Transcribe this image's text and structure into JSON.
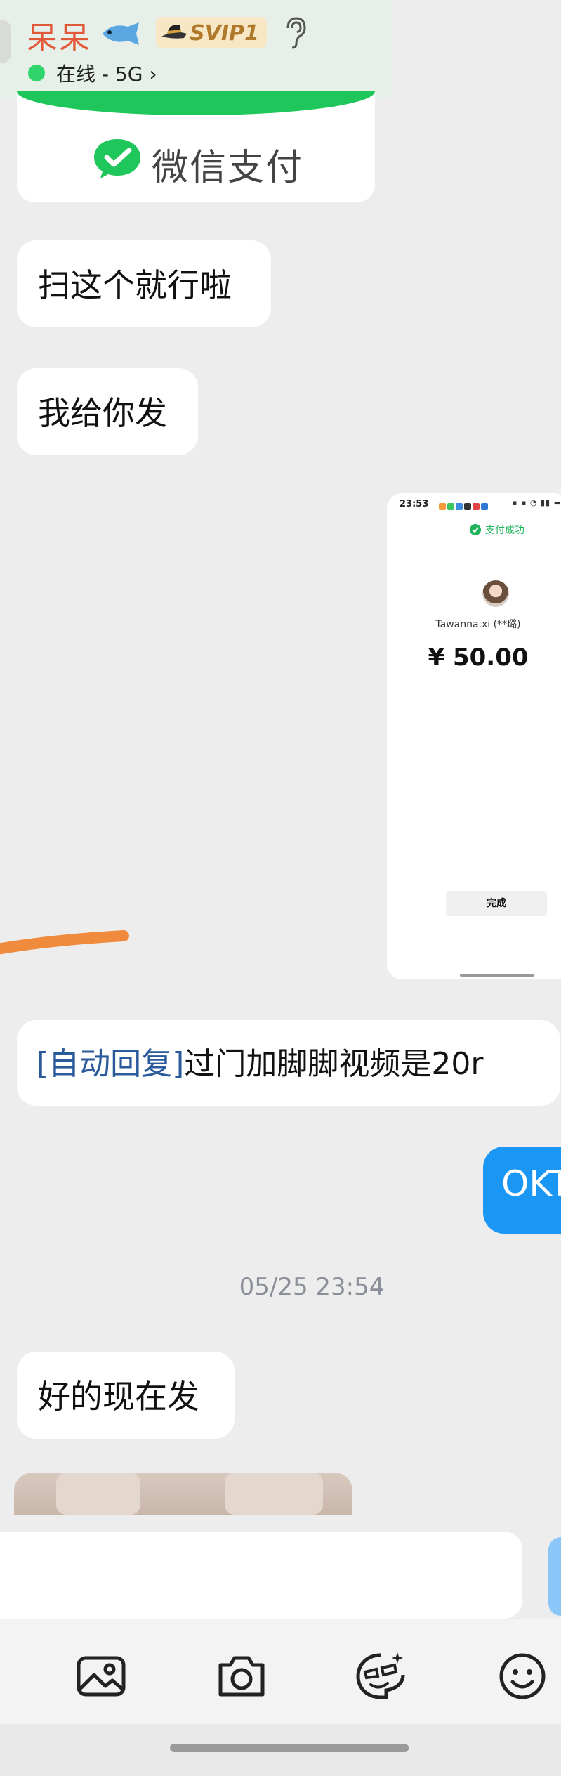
{
  "header": {
    "contact_name": "呆呆",
    "vip_label": "SVIP1",
    "status": "在线 - 5G",
    "status_chevron": "›",
    "icons": [
      "fish-emoji-icon",
      "hat-icon",
      "ear-icon",
      "status-dot-icon",
      "chevron-right-icon"
    ],
    "status_dot_color": "#2fd46a",
    "name_color": "#e2593a"
  },
  "messages": {
    "pay_card_label": "微信支付",
    "m1": "扫这个就行啦",
    "m2": "我给你发",
    "auto_reply_tag": "[自动回复]",
    "auto_reply_text": "过门加脚脚视频是20r",
    "my_reply": "OKT",
    "timestamp": "05/25 23:54",
    "m4": "好的现在发"
  },
  "payment_screenshot": {
    "time": "23:53",
    "status_title": "支付成功",
    "payee": "Tawanna.xi (**璐)",
    "amount": "¥ 50.00",
    "done_button": "完成",
    "brand_color": "#1fb35b"
  },
  "input": {
    "placeholder": ""
  },
  "toolbar": {
    "icons": [
      "image-icon",
      "camera-icon",
      "sticker-icon",
      "emoji-icon"
    ]
  },
  "colors": {
    "my_bubble": "#1a96f4",
    "wechat_green": "#1fc65b",
    "auto_reply_tag": "#2a5a9c"
  }
}
